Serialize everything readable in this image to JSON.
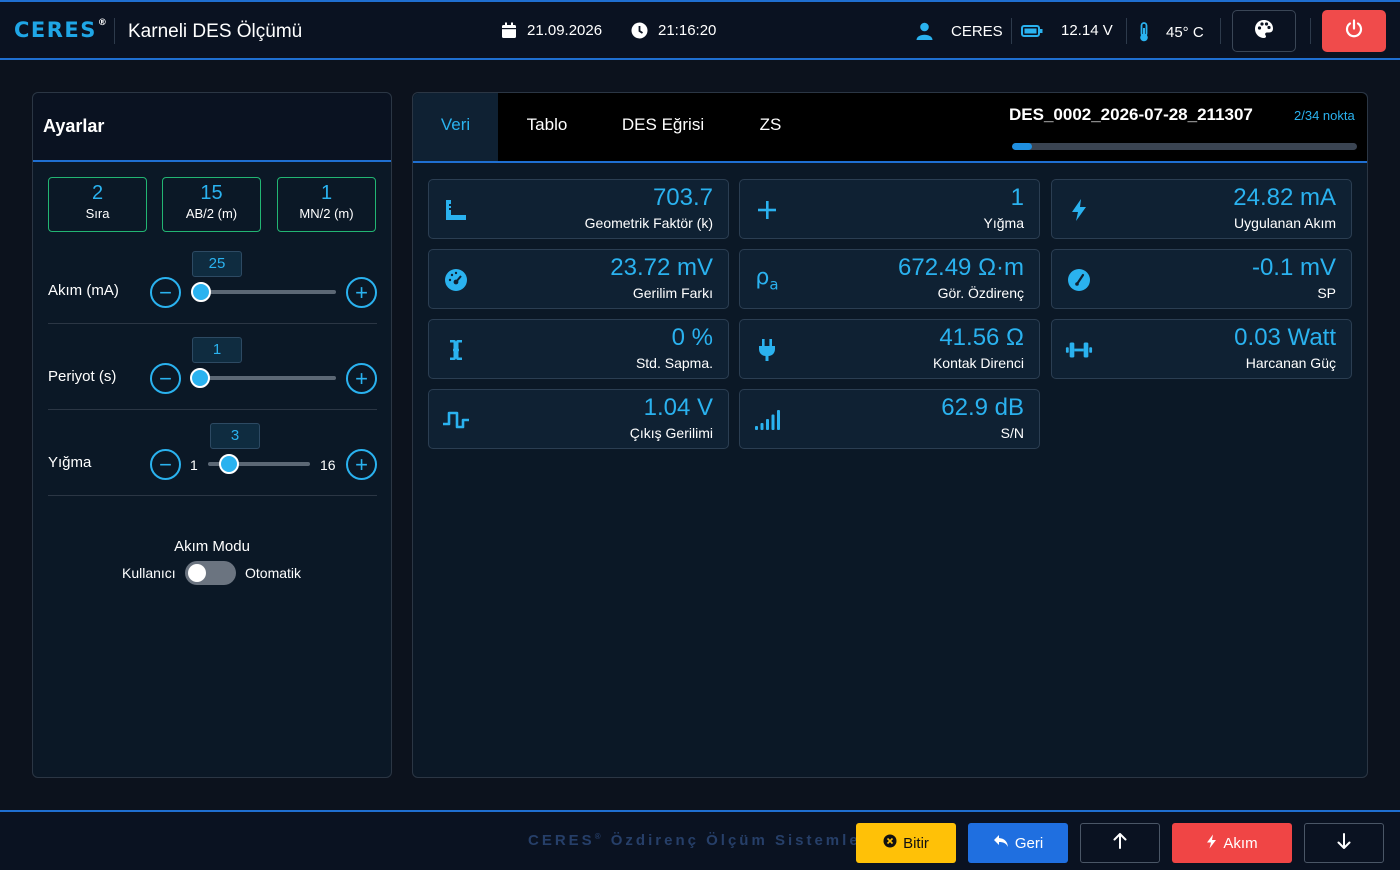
{
  "header": {
    "logo": "CERES",
    "logo_mark": "®",
    "title": "Karneli DES Ölçümü",
    "date": "21.09.2026",
    "time": "21:16:20",
    "user": "CERES",
    "voltage": "12.14 V",
    "temperature": "45° C",
    "icons": [
      "calendar-icon",
      "clock-icon",
      "user-icon",
      "battery-icon",
      "thermometer-icon",
      "palette-icon",
      "power-icon"
    ]
  },
  "settings": {
    "title": "Ayarlar",
    "info": [
      {
        "value": "2",
        "label": "Sıra"
      },
      {
        "value": "15",
        "label": "AB/2 (m)"
      },
      {
        "value": "1",
        "label": "MN/2 (m)"
      }
    ],
    "current": {
      "label": "Akım (mA)",
      "value": "25",
      "level": 0
    },
    "period": {
      "label": "Periyot (s)",
      "value": "1",
      "level": 0
    },
    "stacking": {
      "label": "Yığma",
      "value": "3",
      "min": "1",
      "max": "16"
    },
    "mode": {
      "title": "Akım Modu",
      "left": "Kullanıcı",
      "right": "Otomatik",
      "checked": false
    }
  },
  "tabs": [
    "Veri",
    "Tablo",
    "DES Eğrisi",
    "ZS"
  ],
  "active_tab": "Veri",
  "file": {
    "name": "DES_0002_2026-07-28_211307",
    "points": "2/34 nokta",
    "progress": 0.059
  },
  "cards": [
    {
      "icon": "ruler-icon",
      "value": "703.7",
      "label": "Geometrik Faktör (k)"
    },
    {
      "icon": "plus-icon",
      "value": "1",
      "label": "Yığma"
    },
    {
      "icon": "bolt-icon",
      "value": "24.82 mA",
      "label": "Uygulanan Akım"
    },
    {
      "icon": "gauge-icon",
      "value": "23.72 mV",
      "label": "Gerilim Farkı"
    },
    {
      "icon": "rho-icon",
      "icon_text": "ρ",
      "icon_sub": "a",
      "value": "672.49 Ω·m",
      "label": "Gör. Özdirenç"
    },
    {
      "icon": "dial-icon",
      "value": "-0.1 mV",
      "label": "SP"
    },
    {
      "icon": "text-cursor-icon",
      "value": "0 %",
      "label": "Std. Sapma."
    },
    {
      "icon": "plug-icon",
      "value": "41.56 Ω",
      "label": "Kontak Direnci"
    },
    {
      "icon": "dumbbell-icon",
      "value": "0.03 Watt",
      "label": "Harcanan Güç"
    },
    {
      "icon": "pulse-wave-icon",
      "value": "1.04 V",
      "label": "Çıkış Gerilimi"
    },
    {
      "icon": "signal-bars-icon",
      "value": "62.9 dB",
      "label": "S/N"
    }
  ],
  "footer": {
    "brand": "CERES",
    "brand_mark": "®",
    "tagline": "Özdirenç Ölçüm Sistemleri",
    "buttons": {
      "finish": "Bitir",
      "back": "Geri",
      "current": "Akım"
    }
  },
  "colors": {
    "accent": "#2ab2ef",
    "border_blue": "#1f6fd1",
    "danger": "#f04b4b",
    "warning": "#ffc107",
    "success": "#22b573"
  }
}
